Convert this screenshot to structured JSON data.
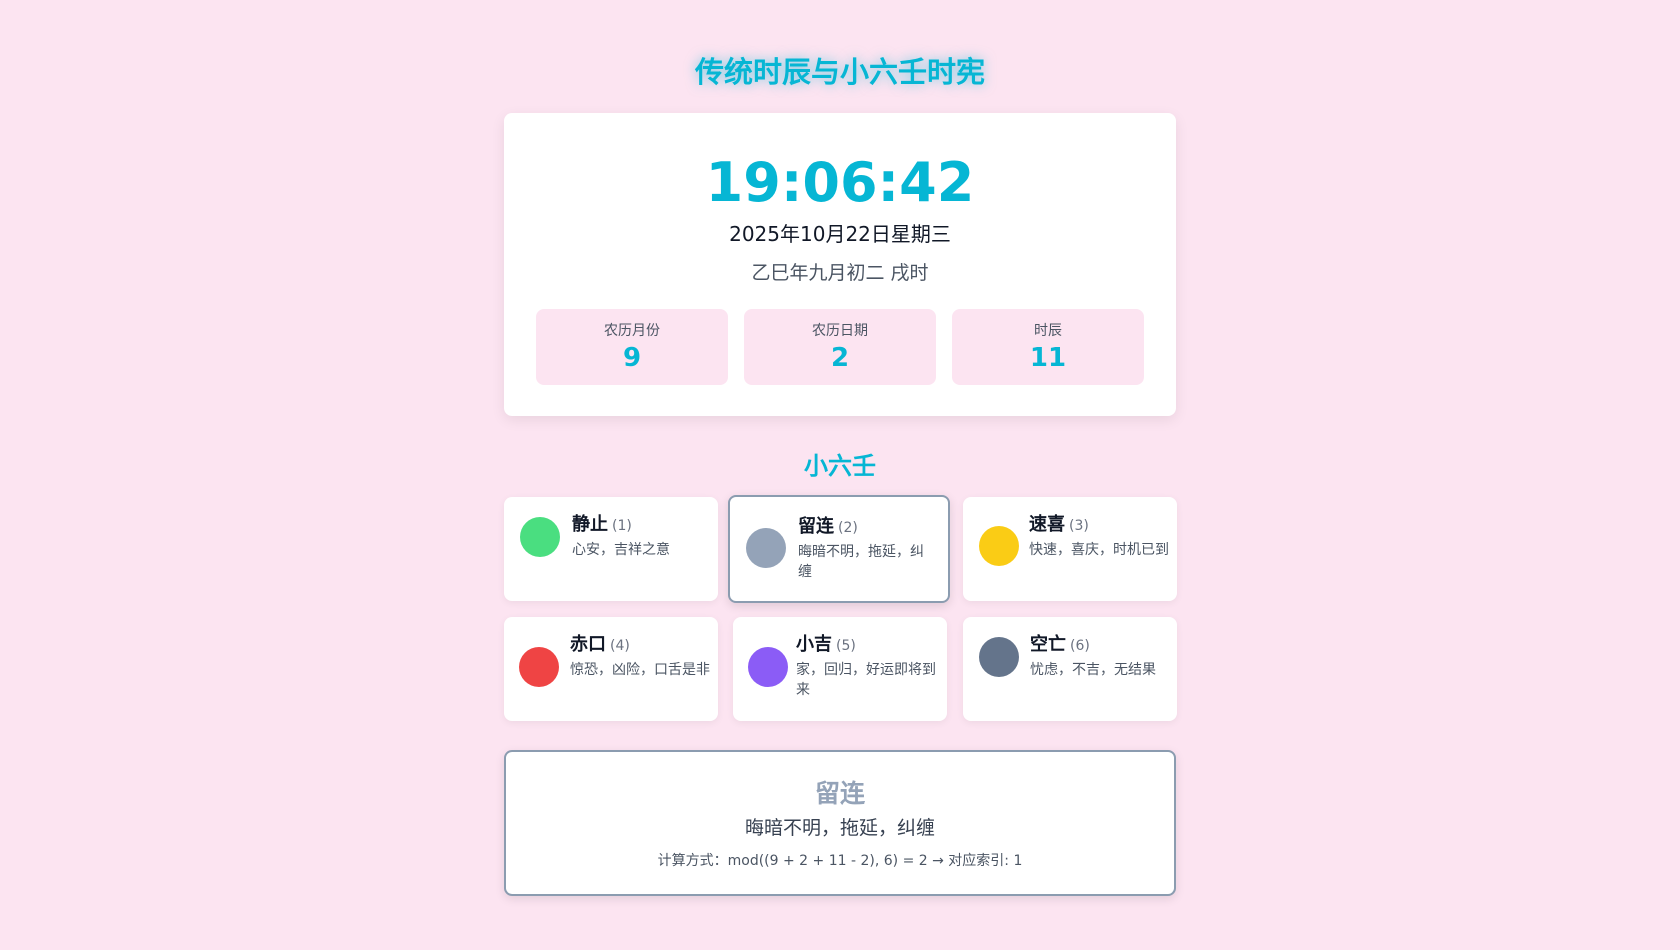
{
  "header": {
    "title": "传统时辰与小六壬时宪"
  },
  "clock": {
    "time": "19:06:42",
    "date": "2025年10月22日星期三",
    "lunar": "乙巳年九月初二 戌时",
    "stats": [
      {
        "label": "农历月份",
        "value": "9"
      },
      {
        "label": "农历日期",
        "value": "2"
      },
      {
        "label": "时辰",
        "value": "11"
      }
    ]
  },
  "section": {
    "title": "小六壬"
  },
  "gods": [
    {
      "name": "静止",
      "num": "(1)",
      "desc": "心安，吉祥之意",
      "color": "#4ade80",
      "active": false
    },
    {
      "name": "留连",
      "num": "(2)",
      "desc": "晦暗不明，拖延，纠缠",
      "color": "#94a3b8",
      "active": true
    },
    {
      "name": "速喜",
      "num": "(3)",
      "desc": "快速，喜庆，时机已到",
      "color": "#facc15",
      "active": false
    },
    {
      "name": "赤口",
      "num": "(4)",
      "desc": "惊恐，凶险，口舌是非",
      "color": "#ef4444",
      "active": false
    },
    {
      "name": "小吉",
      "num": "(5)",
      "desc": "家，回归，好运即将到来",
      "color": "#8b5cf6",
      "active": false
    },
    {
      "name": "空亡",
      "num": "(6)",
      "desc": "忧虑，不吉，无结果",
      "color": "#64748b",
      "active": false
    }
  ],
  "result": {
    "name": "留连",
    "desc": "晦暗不明，拖延，纠缠",
    "formula": "计算方式：mod((9 + 2 + 11 - 2), 6) = 2 → 对应索引: 1",
    "color": "#94a3b8"
  }
}
